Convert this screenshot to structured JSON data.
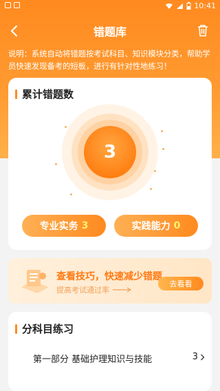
{
  "status_bar": {
    "time": "10:41"
  },
  "header": {
    "title": "错题库"
  },
  "description": "说明：系统自动将错题按考试科目、知识模块分类，帮助学员快速发现备考的短板，进行有针对性地练习！",
  "summary": {
    "title": "累计错题数",
    "total": "3",
    "pills": [
      {
        "label": "专业实务",
        "count": "3"
      },
      {
        "label": "实践能力",
        "count": "0"
      }
    ]
  },
  "banner": {
    "title": "查看技巧，快速减少错题",
    "subtitle": "提高考试通过率",
    "button": "去看看"
  },
  "subjects": {
    "title": "分科目练习",
    "items": [
      {
        "label": "第一部分  基础护理知识与技能",
        "count": "3"
      }
    ]
  },
  "colors": {
    "accent": "#ff8a1f",
    "count_highlight": "#fff36b"
  }
}
